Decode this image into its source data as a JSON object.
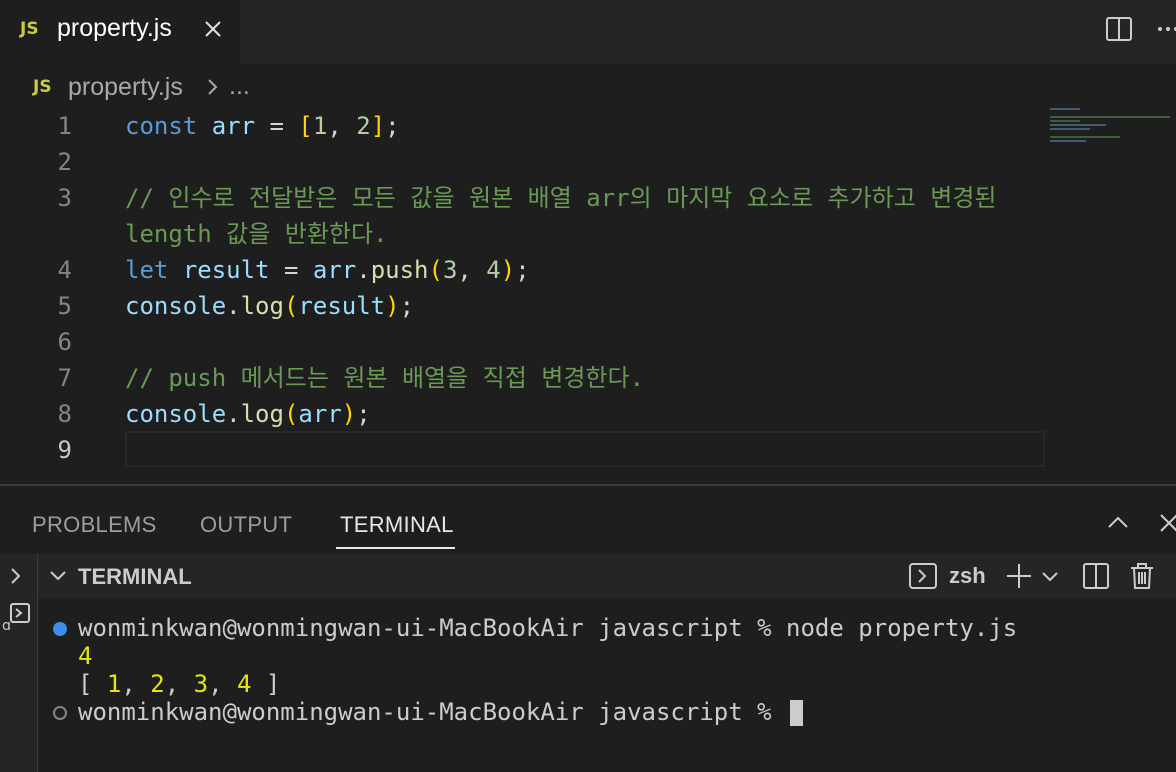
{
  "tab": {
    "badge": "JS",
    "title": "property.js"
  },
  "breadcrumb": {
    "badge": "JS",
    "file": "property.js",
    "ellipsis": "..."
  },
  "editor": {
    "line_numbers": [
      "1",
      "2",
      "3",
      "4",
      "5",
      "6",
      "7",
      "8",
      "9"
    ],
    "lines": {
      "l1": {
        "kw": "const",
        "var": "arr",
        "op": " = ",
        "open": "[",
        "n1": "1",
        "sep": ", ",
        "n2": "2",
        "close": "]",
        "end": ";"
      },
      "l3a": "// 인수로 전달받은 모든 값을 원본 배열 arr의 마지막 요소로 추가하고 변경된",
      "l3b": "length 값을 반환한다.",
      "l4": {
        "kw": "let",
        "var1": "result",
        "op": " = ",
        "var2": "arr",
        "dot": ".",
        "fn": "push",
        "open": "(",
        "n1": "3",
        "sep": ", ",
        "n2": "4",
        "close": ")",
        "end": ";"
      },
      "l5": {
        "var1": "console",
        "dot": ".",
        "fn": "log",
        "open": "(",
        "var2": "result",
        "close": ")",
        "end": ";"
      },
      "l7": "// push 메서드는 원본 배열을 직접 변경한다.",
      "l8": {
        "var1": "console",
        "dot": ".",
        "fn": "log",
        "open": "(",
        "var2": "arr",
        "close": ")",
        "end": ";"
      }
    }
  },
  "panel": {
    "tabs": [
      "PROBLEMS",
      "OUTPUT",
      "TERMINAL"
    ],
    "active_tab": "TERMINAL",
    "terminal_title": "TERMINAL",
    "shell": "zsh"
  },
  "terminal": {
    "prompt1": "wonminkwan@wonmingwan-ui-MacBookAir javascript % node property.js",
    "output1": "4",
    "output2": {
      "open": "[ ",
      "n1": "1",
      "n2": "2",
      "n3": "3",
      "n4": "4",
      "sep": ", ",
      "close": " ]"
    },
    "prompt2": "wonminkwan@wonmingwan-ui-MacBookAir javascript % "
  },
  "colors": {
    "keyword": "#569cd6",
    "variable": "#9cdcfe",
    "function": "#dcdcaa",
    "number": "#b5cea8",
    "comment": "#6a9955",
    "bracket": "#ffd700",
    "js_badge": "#cbcb41",
    "dot_success": "#3b8eea"
  },
  "icons": [
    "close-icon",
    "split-editor-icon",
    "more-actions-icon",
    "chevron-right-icon",
    "chevron-up-icon",
    "terminal-shell-icon",
    "plus-icon",
    "chevron-down-icon",
    "split-terminal-icon",
    "trash-icon"
  ]
}
